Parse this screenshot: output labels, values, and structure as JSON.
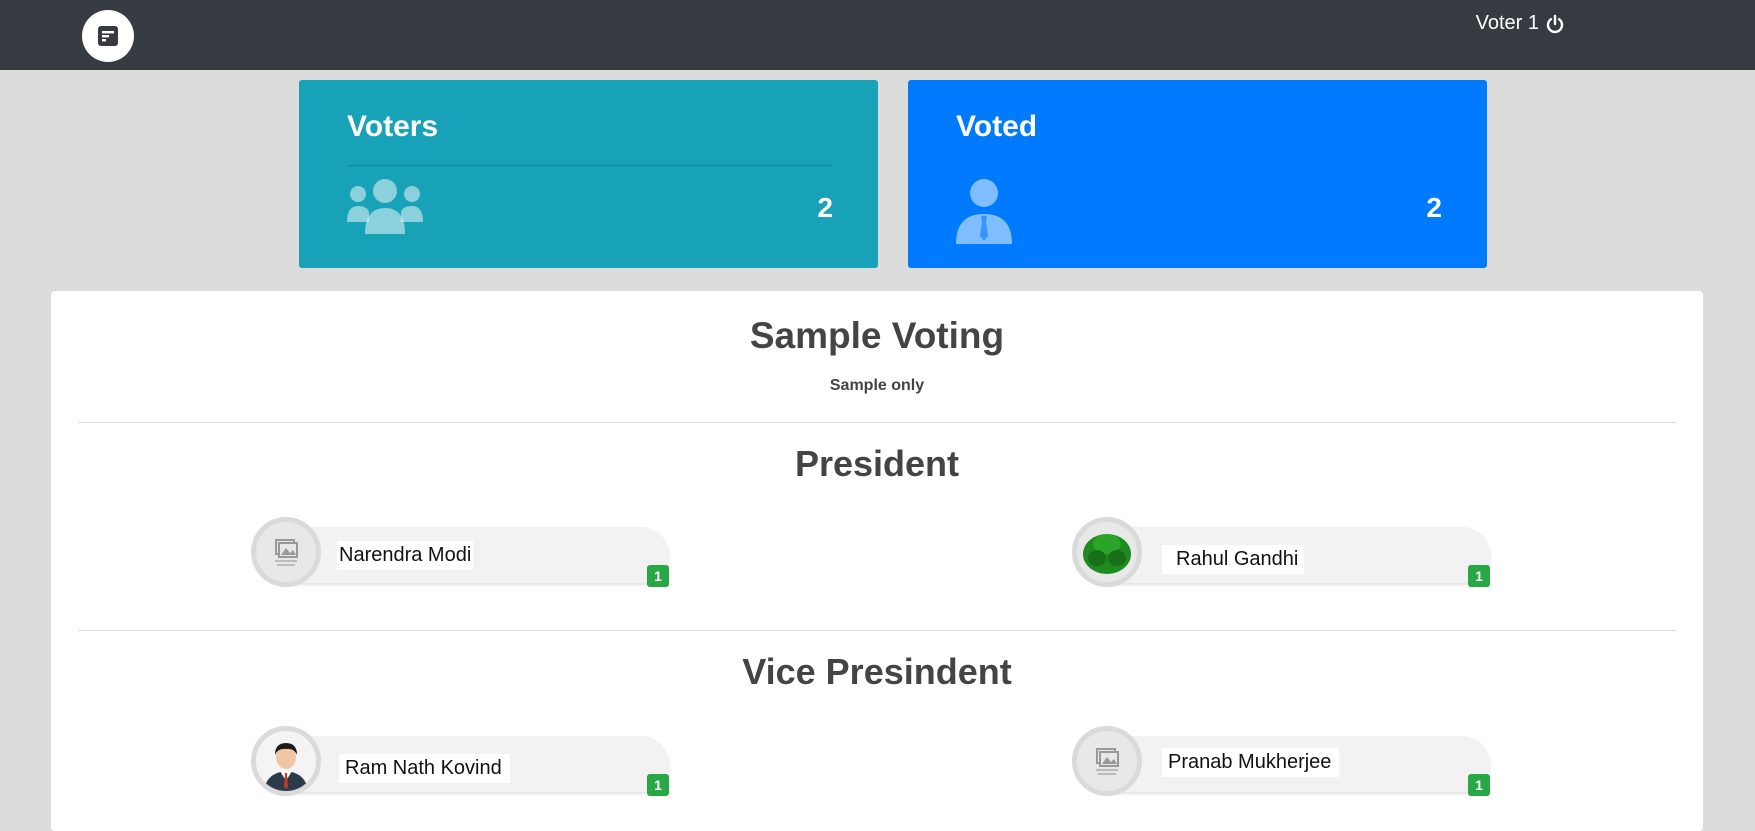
{
  "header": {
    "logo_icon": "poll-icon",
    "user_label": "Voter 1",
    "logout_icon": "power-icon"
  },
  "cards": {
    "voters": {
      "title": "Voters",
      "count": "2",
      "icon": "users-icon",
      "color": "#17a2b8"
    },
    "voted": {
      "title": "Voted",
      "count": "2",
      "icon": "user-tie-icon",
      "color": "#007bff"
    }
  },
  "poll": {
    "title": "Sample Voting",
    "subtitle": "Sample only",
    "positions": [
      {
        "title": "President",
        "candidates": [
          {
            "name": "Narendra Modi",
            "votes": "1",
            "photo": "image-not-available-icon"
          },
          {
            "name": "Rahul Gandhi",
            "votes": "1",
            "photo": "green-symbol-photo"
          }
        ]
      },
      {
        "title": "Vice Presindent",
        "candidates": [
          {
            "name": "Ram Nath Kovind",
            "votes": "1",
            "photo": "man-avatar-photo"
          },
          {
            "name": "Pranab Mukherjee",
            "votes": "1",
            "photo": "image-not-available-icon"
          }
        ]
      }
    ]
  },
  "colors": {
    "topbar": "#363a41",
    "badge": "#28a745",
    "background": "#dcdcdc"
  }
}
